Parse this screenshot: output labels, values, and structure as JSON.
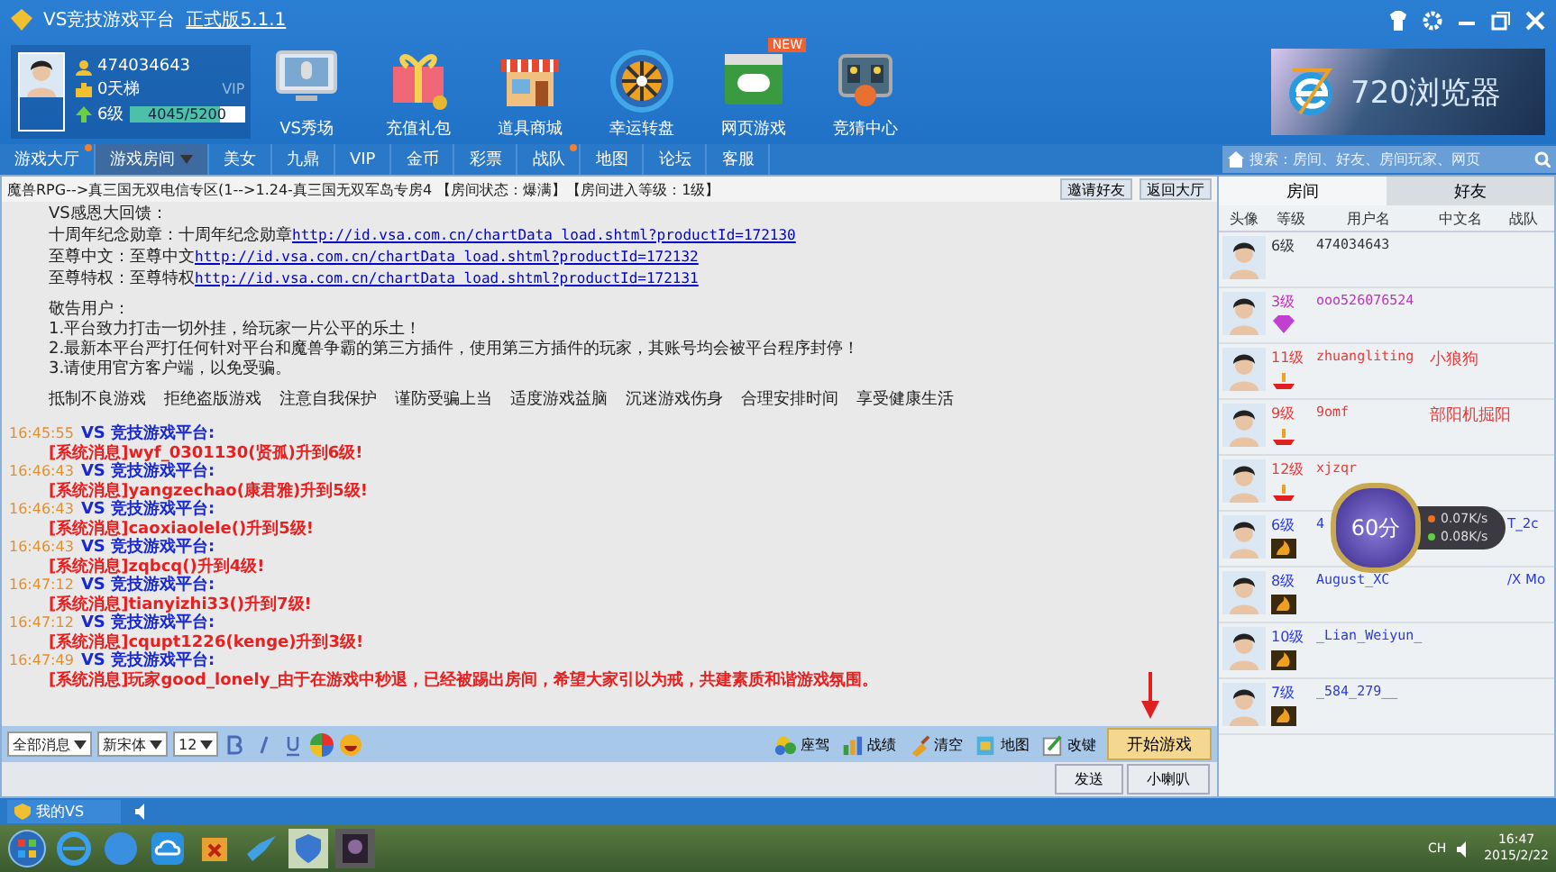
{
  "window": {
    "title": "VS竞技游戏平台",
    "version": "正式版5.1.1"
  },
  "profile": {
    "id": "474034643",
    "ladder": "0天梯",
    "vip": "VIP",
    "level_label": "6级",
    "exp": "4045/5200",
    "level": 0.78
  },
  "features": [
    {
      "label": "VS秀场",
      "kind": "monitor"
    },
    {
      "label": "充值礼包",
      "kind": "gift"
    },
    {
      "label": "道具商城",
      "kind": "shop"
    },
    {
      "label": "幸运转盘",
      "kind": "wheel"
    },
    {
      "label": "网页游戏",
      "kind": "game",
      "badge": "NEW"
    },
    {
      "label": "竞猜中心",
      "kind": "quiz"
    }
  ],
  "ad": {
    "text": "720浏览器"
  },
  "nav_tabs": [
    {
      "label": "游戏大厅",
      "selected": false,
      "notify": true
    },
    {
      "label": "游戏房间",
      "selected": true,
      "notify": false
    },
    {
      "label": "美女",
      "selected": false,
      "notify": false
    },
    {
      "label": "九鼎",
      "selected": false,
      "notify": false
    },
    {
      "label": "VIP",
      "selected": false,
      "notify": false
    },
    {
      "label": "金币",
      "selected": false,
      "notify": false
    },
    {
      "label": "彩票",
      "selected": false,
      "notify": false
    },
    {
      "label": "战队",
      "selected": false,
      "notify": true
    },
    {
      "label": "地图",
      "selected": false,
      "notify": false
    },
    {
      "label": "论坛",
      "selected": false,
      "notify": false
    },
    {
      "label": "客服",
      "selected": false,
      "notify": false
    }
  ],
  "search": {
    "placeholder": "搜索：房间、好友、房间玩家、网页"
  },
  "room": {
    "info": "魔兽RPG-->真三国无双电信专区(1-->1.24-真三国无双军岛专房4 【房间状态：爆满】【房间进入等级：1级】",
    "buttons": [
      "邀请好友",
      "返回大厅"
    ]
  },
  "announcement": {
    "title": "VS感恩大回馈：",
    "links": [
      {
        "label": "十周年纪念勋章：十周年纪念勋章",
        "url": "http://id.vsa.com.cn/chartData_load.shtml?productId=172130"
      },
      {
        "label": "至尊中文：至尊中文",
        "url": "http://id.vsa.com.cn/chartData_load.shtml?productId=172132"
      },
      {
        "label": "至尊特权：至尊特权",
        "url": "http://id.vsa.com.cn/chartData_load.shtml?productId=172131"
      }
    ],
    "notice_title": "敬告用户：",
    "notices": [
      "1.平台致力打击一切外挂，给玩家一片公平的乐土！",
      "2.最新本平台严打任何针对平台和魔兽争霸的第三方插件，使用第三方插件的玩家，其账号均会被平台程序封停！",
      "3.请使用官方客户端，以免受骗。"
    ],
    "slogans": [
      "抵制不良游戏",
      "拒绝盗版游戏",
      "注意自我保护",
      "谨防受骗上当",
      "适度游戏益脑",
      "沉迷游戏伤身",
      "合理安排时间",
      "享受健康生活"
    ]
  },
  "chat": [
    {
      "time": "16:45:55",
      "sender": "VS 竞技游戏平台:",
      "message": "[系统消息]wyf_0301130(贤孤)升到6级!"
    },
    {
      "time": "16:46:43",
      "sender": "VS 竞技游戏平台:",
      "message": "[系统消息]yangzechao(康君雅)升到5级!"
    },
    {
      "time": "16:46:43",
      "sender": "VS 竞技游戏平台:",
      "message": "[系统消息]caoxiaolele()升到5级!"
    },
    {
      "time": "16:46:43",
      "sender": "VS 竞技游戏平台:",
      "message": "[系统消息]zqbcq()升到4级!"
    },
    {
      "time": "16:47:12",
      "sender": "VS 竞技游戏平台:",
      "message": "[系统消息]tianyizhi33()升到7级!"
    },
    {
      "time": "16:47:12",
      "sender": "VS 竞技游戏平台:",
      "message": "[系统消息]cqupt1226(kenge)升到3级!"
    },
    {
      "time": "16:47:49",
      "sender": "VS 竞技游戏平台:",
      "message": "[系统消息]玩家good_lonely_由于在游戏中秒退，已经被踢出房间，希望大家引以为戒，共建素质和谐游戏氛围。"
    }
  ],
  "compose": {
    "filter": "全部消息",
    "font": "新宋体",
    "size": "12",
    "tools": [
      {
        "label": "座驾",
        "kind": "car"
      },
      {
        "label": "战绩",
        "kind": "chart"
      },
      {
        "label": "清空",
        "kind": "broom"
      },
      {
        "label": "地图",
        "kind": "map"
      },
      {
        "label": "改键",
        "kind": "edit"
      }
    ],
    "start": "开始游戏",
    "send": "发送",
    "horn": "小喇叭"
  },
  "sidebar": {
    "tabs": [
      {
        "label": "房间",
        "selected": true
      },
      {
        "label": "好友",
        "selected": false
      }
    ],
    "columns": [
      "头像",
      "等级",
      "用户名",
      "中文名",
      "战队"
    ],
    "players": [
      {
        "level": "6级",
        "username": "474034643",
        "color": "#333333",
        "kind": "plain"
      },
      {
        "level": "3级",
        "username": "ooo526076524",
        "color": "#c030c0",
        "kind": "diamond"
      },
      {
        "level": "11级",
        "username": "zhuangliting",
        "chinese_name": "小狼狗",
        "color": "#e83a3a",
        "kind": "candle"
      },
      {
        "level": "9级",
        "username": "9omf",
        "chinese_name": "部阳机掘阳",
        "color": "#e83a3a",
        "kind": "candle"
      },
      {
        "level": "12级",
        "username": "xjzqr",
        "color": "#e83a3a",
        "kind": "candle"
      },
      {
        "level": "6级",
        "username": "4",
        "team": "T_2c",
        "color": "#2a3ae0",
        "kind": "flame"
      },
      {
        "level": "8级",
        "username": "August_XC",
        "team": "/X Mo",
        "color": "#2a3ae0",
        "kind": "flame"
      },
      {
        "level": "10级",
        "username": "_Lian_Weiyun_",
        "color": "#2a3ae0",
        "kind": "flame"
      },
      {
        "level": "7级",
        "username": "_584_279__",
        "color": "#2a3ae0",
        "kind": "flame"
      }
    ]
  },
  "speed_widget": {
    "score": "60分",
    "up": "0.07K/s",
    "down": "0.08K/s"
  },
  "status_bar": {
    "label": "我的VS"
  },
  "taskbar": {
    "tray_text": "CH",
    "time": "16:47",
    "date": "2015/2/22"
  }
}
